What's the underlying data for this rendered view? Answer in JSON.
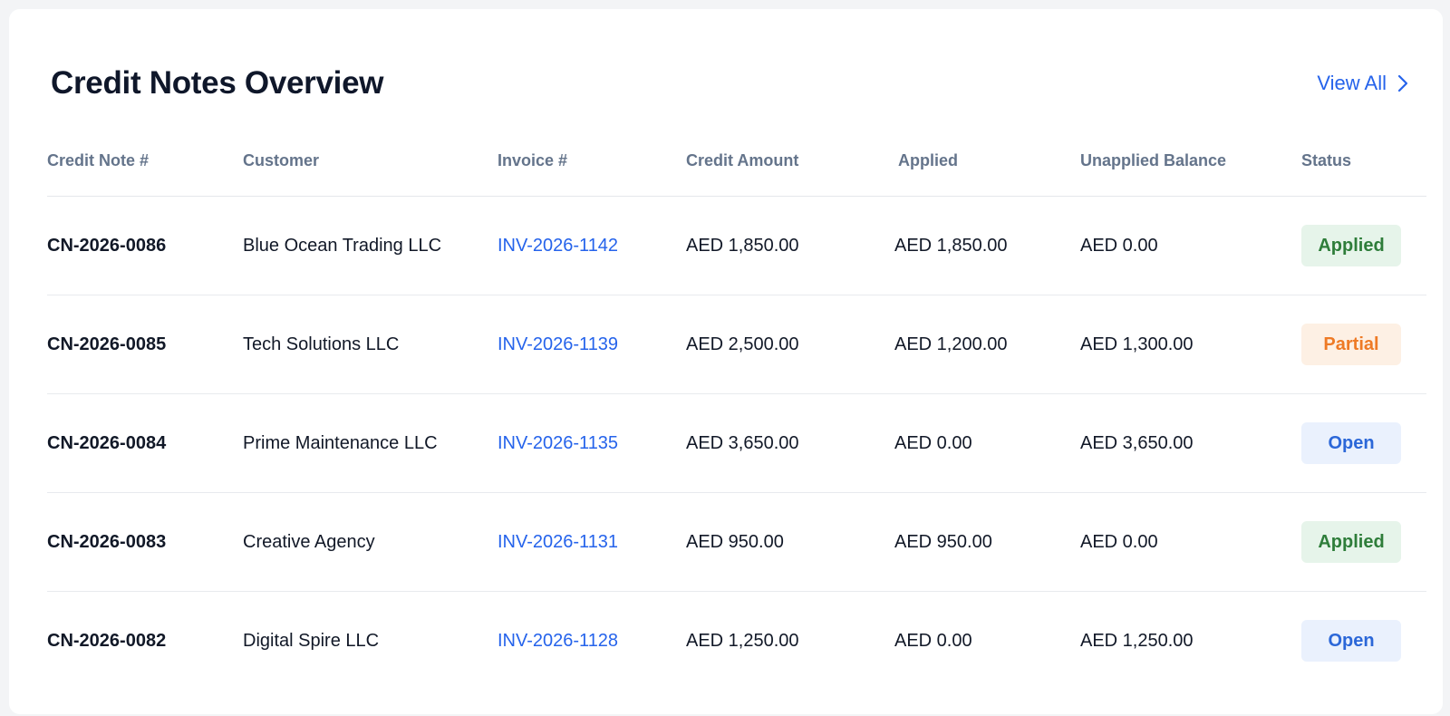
{
  "header": {
    "title": "Credit Notes Overview",
    "view_all_label": "View All"
  },
  "table": {
    "columns": [
      "Credit Note #",
      "Customer",
      "Invoice #",
      "Credit Amount",
      "Applied",
      "Unapplied Balance",
      "Status"
    ],
    "rows": [
      {
        "credit_note": "CN-2026-0086",
        "customer": "Blue Ocean Trading LLC",
        "invoice": "INV-2026-1142",
        "credit_amount": "AED 1,850.00",
        "applied": "AED 1,850.00",
        "unapplied": "AED 0.00",
        "status": "Applied"
      },
      {
        "credit_note": "CN-2026-0085",
        "customer": "Tech Solutions LLC",
        "invoice": "INV-2026-1139",
        "credit_amount": "AED 2,500.00",
        "applied": "AED 1,200.00",
        "unapplied": "AED 1,300.00",
        "status": "Partial"
      },
      {
        "credit_note": "CN-2026-0084",
        "customer": "Prime Maintenance LLC",
        "invoice": "INV-2026-1135",
        "credit_amount": "AED 3,650.00",
        "applied": "AED 0.00",
        "unapplied": "AED 3,650.00",
        "status": "Open"
      },
      {
        "credit_note": "CN-2026-0083",
        "customer": "Creative Agency",
        "invoice": "INV-2026-1131",
        "credit_amount": "AED 950.00",
        "applied": "AED 950.00",
        "unapplied": "AED 0.00",
        "status": "Applied"
      },
      {
        "credit_note": "CN-2026-0082",
        "customer": "Digital Spire LLC",
        "invoice": "INV-2026-1128",
        "credit_amount": "AED 1,250.00",
        "applied": "AED 0.00",
        "unapplied": "AED 1,250.00",
        "status": "Open"
      }
    ]
  },
  "colors": {
    "link": "#2563eb",
    "applied_bg": "#e6f4ea",
    "applied_fg": "#2e7d3a",
    "partial_bg": "#fdf0e4",
    "partial_fg": "#ee7a25",
    "open_bg": "#eaf1fd",
    "open_fg": "#2b67d8"
  },
  "icons": {
    "view_all": "chevron-right-icon"
  }
}
